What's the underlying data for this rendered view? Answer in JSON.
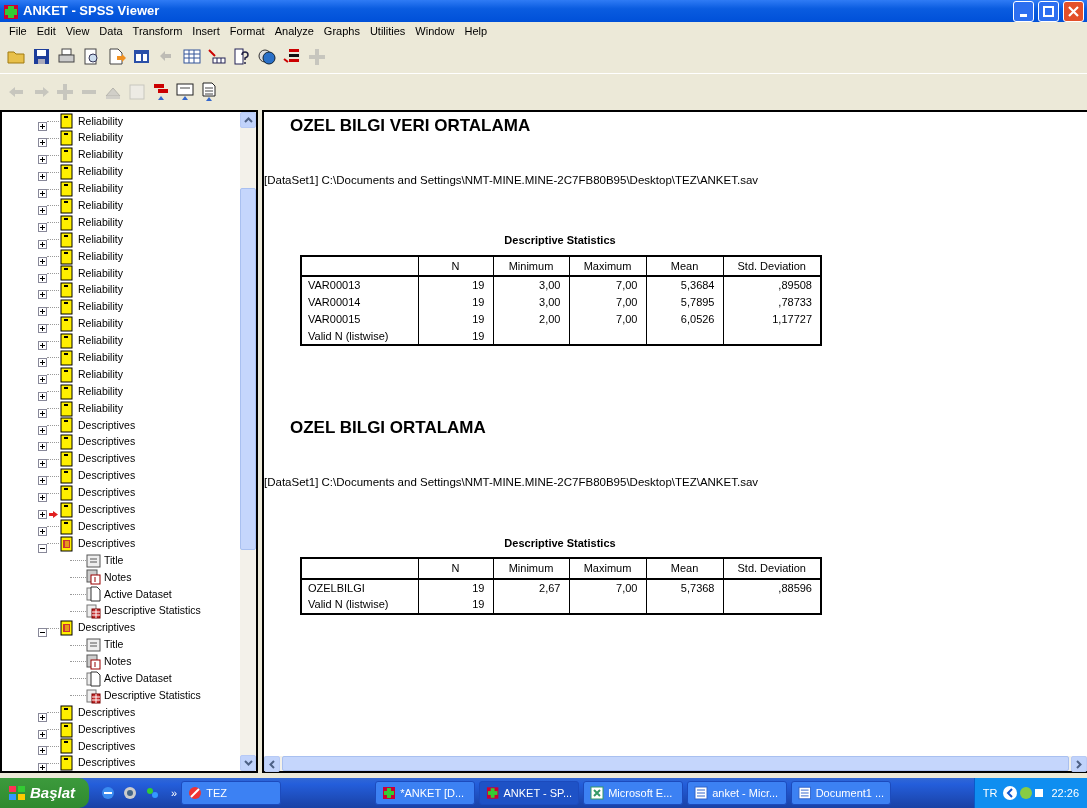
{
  "window": {
    "title": "ANKET - SPSS Viewer"
  },
  "menu": [
    "File",
    "Edit",
    "View",
    "Data",
    "Transform",
    "Insert",
    "Format",
    "Analyze",
    "Graphs",
    "Utilities",
    "Window",
    "Help"
  ],
  "toolbar_main": [
    {
      "kind": "open",
      "disabled": false
    },
    {
      "kind": "save",
      "disabled": false
    },
    {
      "kind": "print",
      "disabled": false
    },
    {
      "kind": "preview",
      "disabled": false
    },
    {
      "kind": "export",
      "disabled": false
    },
    {
      "kind": "recall",
      "disabled": false
    },
    {
      "kind": "undo",
      "disabled": true
    },
    {
      "kind": "grid",
      "disabled": false
    },
    {
      "kind": "vars",
      "disabled": false
    },
    {
      "kind": "help",
      "disabled": false
    },
    {
      "kind": "circles",
      "disabled": false
    },
    {
      "kind": "chart",
      "disabled": false
    },
    {
      "kind": "plus",
      "disabled": true
    }
  ],
  "toolbar_outline": [
    {
      "kind": "back",
      "disabled": true
    },
    {
      "kind": "forward",
      "disabled": true
    },
    {
      "kind": "plus",
      "disabled": true
    },
    {
      "kind": "minus",
      "disabled": true
    },
    {
      "kind": "show",
      "disabled": true
    },
    {
      "kind": "hide",
      "disabled": true
    },
    {
      "kind": "heading",
      "disabled": false
    },
    {
      "kind": "title",
      "disabled": false
    },
    {
      "kind": "text",
      "disabled": false
    }
  ],
  "outline": [
    {
      "label": "Reliability",
      "expanded": false,
      "current": false
    },
    {
      "label": "Reliability",
      "expanded": false,
      "current": false
    },
    {
      "label": "Reliability",
      "expanded": false,
      "current": false
    },
    {
      "label": "Reliability",
      "expanded": false,
      "current": false
    },
    {
      "label": "Reliability",
      "expanded": false,
      "current": false
    },
    {
      "label": "Reliability",
      "expanded": false,
      "current": false
    },
    {
      "label": "Reliability",
      "expanded": false,
      "current": false
    },
    {
      "label": "Reliability",
      "expanded": false,
      "current": false
    },
    {
      "label": "Reliability",
      "expanded": false,
      "current": false
    },
    {
      "label": "Reliability",
      "expanded": false,
      "current": false
    },
    {
      "label": "Reliability",
      "expanded": false,
      "current": false
    },
    {
      "label": "Reliability",
      "expanded": false,
      "current": false
    },
    {
      "label": "Reliability",
      "expanded": false,
      "current": false
    },
    {
      "label": "Reliability",
      "expanded": false,
      "current": false
    },
    {
      "label": "Reliability",
      "expanded": false,
      "current": false
    },
    {
      "label": "Reliability",
      "expanded": false,
      "current": false
    },
    {
      "label": "Reliability",
      "expanded": false,
      "current": false
    },
    {
      "label": "Reliability",
      "expanded": false,
      "current": false
    },
    {
      "label": "Descriptives",
      "expanded": false,
      "current": false
    },
    {
      "label": "Descriptives",
      "expanded": false,
      "current": false
    },
    {
      "label": "Descriptives",
      "expanded": false,
      "current": false
    },
    {
      "label": "Descriptives",
      "expanded": false,
      "current": false
    },
    {
      "label": "Descriptives",
      "expanded": false,
      "current": false
    },
    {
      "label": "Descriptives",
      "expanded": false,
      "current": true
    },
    {
      "label": "Descriptives",
      "expanded": false,
      "current": false
    },
    {
      "label": "Descriptives",
      "expanded": true,
      "current": false,
      "children": [
        {
          "label": "Title",
          "kind": "title"
        },
        {
          "label": "Notes",
          "kind": "notes"
        },
        {
          "label": "Active Dataset",
          "kind": "dataset"
        },
        {
          "label": "Descriptive Statistics",
          "kind": "stats"
        }
      ]
    },
    {
      "label": "Descriptives",
      "expanded": true,
      "current": false,
      "children": [
        {
          "label": "Title",
          "kind": "title"
        },
        {
          "label": "Notes",
          "kind": "notes"
        },
        {
          "label": "Active Dataset",
          "kind": "dataset"
        },
        {
          "label": "Descriptive Statistics",
          "kind": "stats"
        }
      ]
    },
    {
      "label": "Descriptives",
      "expanded": false,
      "current": false
    },
    {
      "label": "Descriptives",
      "expanded": false,
      "current": false
    },
    {
      "label": "Descriptives",
      "expanded": false,
      "current": false
    },
    {
      "label": "Descriptives",
      "expanded": false,
      "current": false
    }
  ],
  "output": [
    {
      "heading": "OZEL BILGI VERI ORTALAMA",
      "dataset": "[DataSet1] C:\\Documents and Settings\\NMT-MINE.MINE-2C7FB80B95\\Desktop\\TEZ\\ANKET.sav",
      "table": {
        "title": "Descriptive Statistics",
        "columns": [
          "N",
          "Minimum",
          "Maximum",
          "Mean",
          "Std. Deviation"
        ],
        "rows": [
          {
            "label": "VAR00013",
            "cells": [
              "19",
              "3,00",
              "7,00",
              "5,3684",
              ",89508"
            ]
          },
          {
            "label": "VAR00014",
            "cells": [
              "19",
              "3,00",
              "7,00",
              "5,7895",
              ",78733"
            ]
          },
          {
            "label": "VAR00015",
            "cells": [
              "19",
              "2,00",
              "7,00",
              "6,0526",
              "1,17727"
            ]
          },
          {
            "label": "Valid N (listwise)",
            "cells": [
              "19"
            ]
          }
        ]
      }
    },
    {
      "heading": "OZEL BILGI ORTALAMA",
      "dataset": "[DataSet1] C:\\Documents and Settings\\NMT-MINE.MINE-2C7FB80B95\\Desktop\\TEZ\\ANKET.sav",
      "table": {
        "title": "Descriptive Statistics",
        "columns": [
          "N",
          "Minimum",
          "Maximum",
          "Mean",
          "Std. Deviation"
        ],
        "rows": [
          {
            "label": "OZELBILGI",
            "cells": [
              "19",
              "2,67",
              "7,00",
              "5,7368",
              ",88596"
            ]
          },
          {
            "label": "Valid N (listwise)",
            "cells": [
              "19"
            ]
          }
        ]
      }
    }
  ],
  "taskbar": {
    "start": "Başlat",
    "more": "»",
    "tasks": [
      {
        "label": "TEZ",
        "kind": "stop",
        "selected": false
      },
      {
        "label": "*ANKET [D...",
        "kind": "spss",
        "selected": false
      },
      {
        "label": "ANKET - SP...",
        "kind": "spss",
        "selected": true
      },
      {
        "label": "Microsoft E...",
        "kind": "excel",
        "selected": false
      },
      {
        "label": "anket - Micr...",
        "kind": "word",
        "selected": false
      },
      {
        "label": "Document1 ...",
        "kind": "word",
        "selected": false
      }
    ],
    "language": "TR",
    "clock": "22:26"
  }
}
